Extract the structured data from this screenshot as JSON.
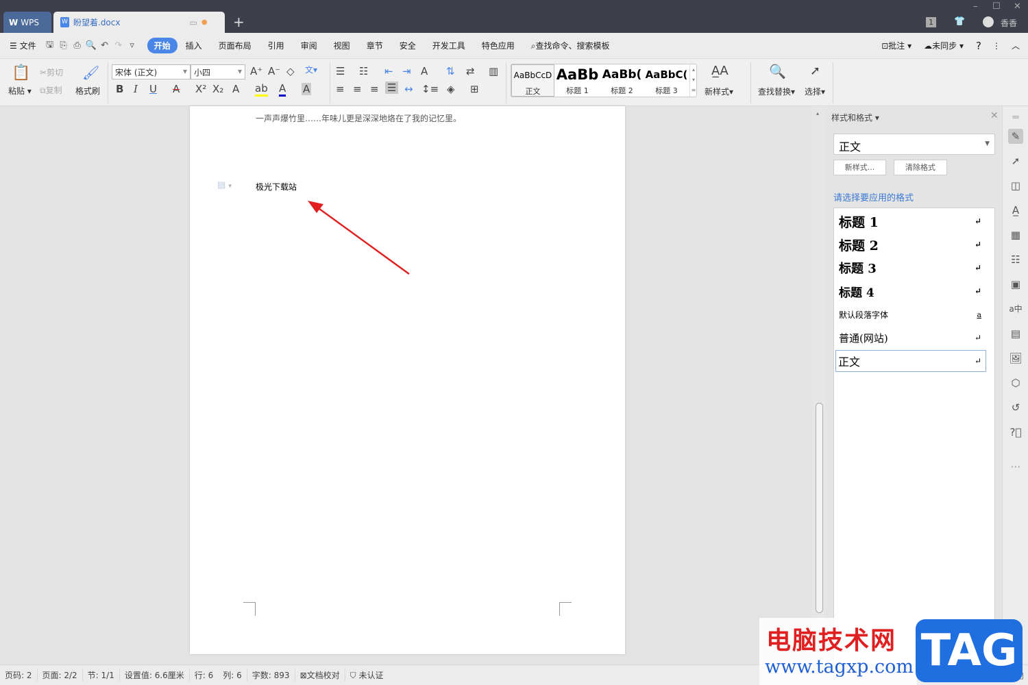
{
  "titlebar": {
    "app_tab": "WPS",
    "doc_tab": "盼望着.docx",
    "new_tab": "+",
    "page_count_badge": "1",
    "user_name": "香香",
    "minimize": "–",
    "maximize": "☐",
    "close": "✕"
  },
  "menubar": {
    "file": "文件",
    "tabs": [
      "开始",
      "插入",
      "页面布局",
      "引用",
      "审阅",
      "视图",
      "章节",
      "安全",
      "开发工具",
      "特色应用"
    ],
    "search": "查找命令、搜索模板",
    "comment": "批注",
    "sync": "未同步",
    "help": "?"
  },
  "ribbon": {
    "paste": "粘贴",
    "cut": "剪切",
    "copy": "复制",
    "format_painter": "格式刷",
    "font_name": "宋体 (正文)",
    "font_size": "小四",
    "styles": [
      {
        "preview": "AaBbCcD",
        "label": "正文"
      },
      {
        "preview": "AaBb",
        "label": "标题 1"
      },
      {
        "preview": "AaBb(",
        "label": "标题 2"
      },
      {
        "preview": "AaBbC(",
        "label": "标题 3"
      }
    ],
    "new_style": "新样式",
    "find_replace": "查找替换",
    "select": "选择"
  },
  "document": {
    "line1": "一声声爆竹里……年味儿更是深深地烙在了我的记忆里。",
    "line2": "极光下载站"
  },
  "panel": {
    "title": "样式和格式",
    "current_style": "正文",
    "new_style_btn": "新样式...",
    "clear_format_btn": "清除格式",
    "prompt": "请选择要应用的格式",
    "styles": [
      {
        "name": "标题  1",
        "mark": "↵"
      },
      {
        "name": "标题  2",
        "mark": "↵"
      },
      {
        "name": "标题  3",
        "mark": "↵"
      },
      {
        "name": "标题  4",
        "mark": "↵"
      },
      {
        "name": "默认段落字体",
        "mark": "a"
      },
      {
        "name": "普通(网站)",
        "mark": "↵"
      },
      {
        "name": "正文",
        "mark": "↵"
      }
    ]
  },
  "status": {
    "page_code": "页码: 2",
    "page": "页面: 2/2",
    "section": "节: 1/1",
    "setting": "设置值: 6.6厘米",
    "row": "行: 6",
    "col": "列: 6",
    "word_count": "字数: 893",
    "proofread": "文档校对",
    "cert": "未认证"
  },
  "watermark": {
    "site_name": "电脑技术网",
    "url": "www.tagxp.com",
    "logo": "TAG"
  },
  "colors": {
    "accent": "#4a86e8",
    "titlebar": "#3d404b",
    "arrow": "#e02020"
  }
}
